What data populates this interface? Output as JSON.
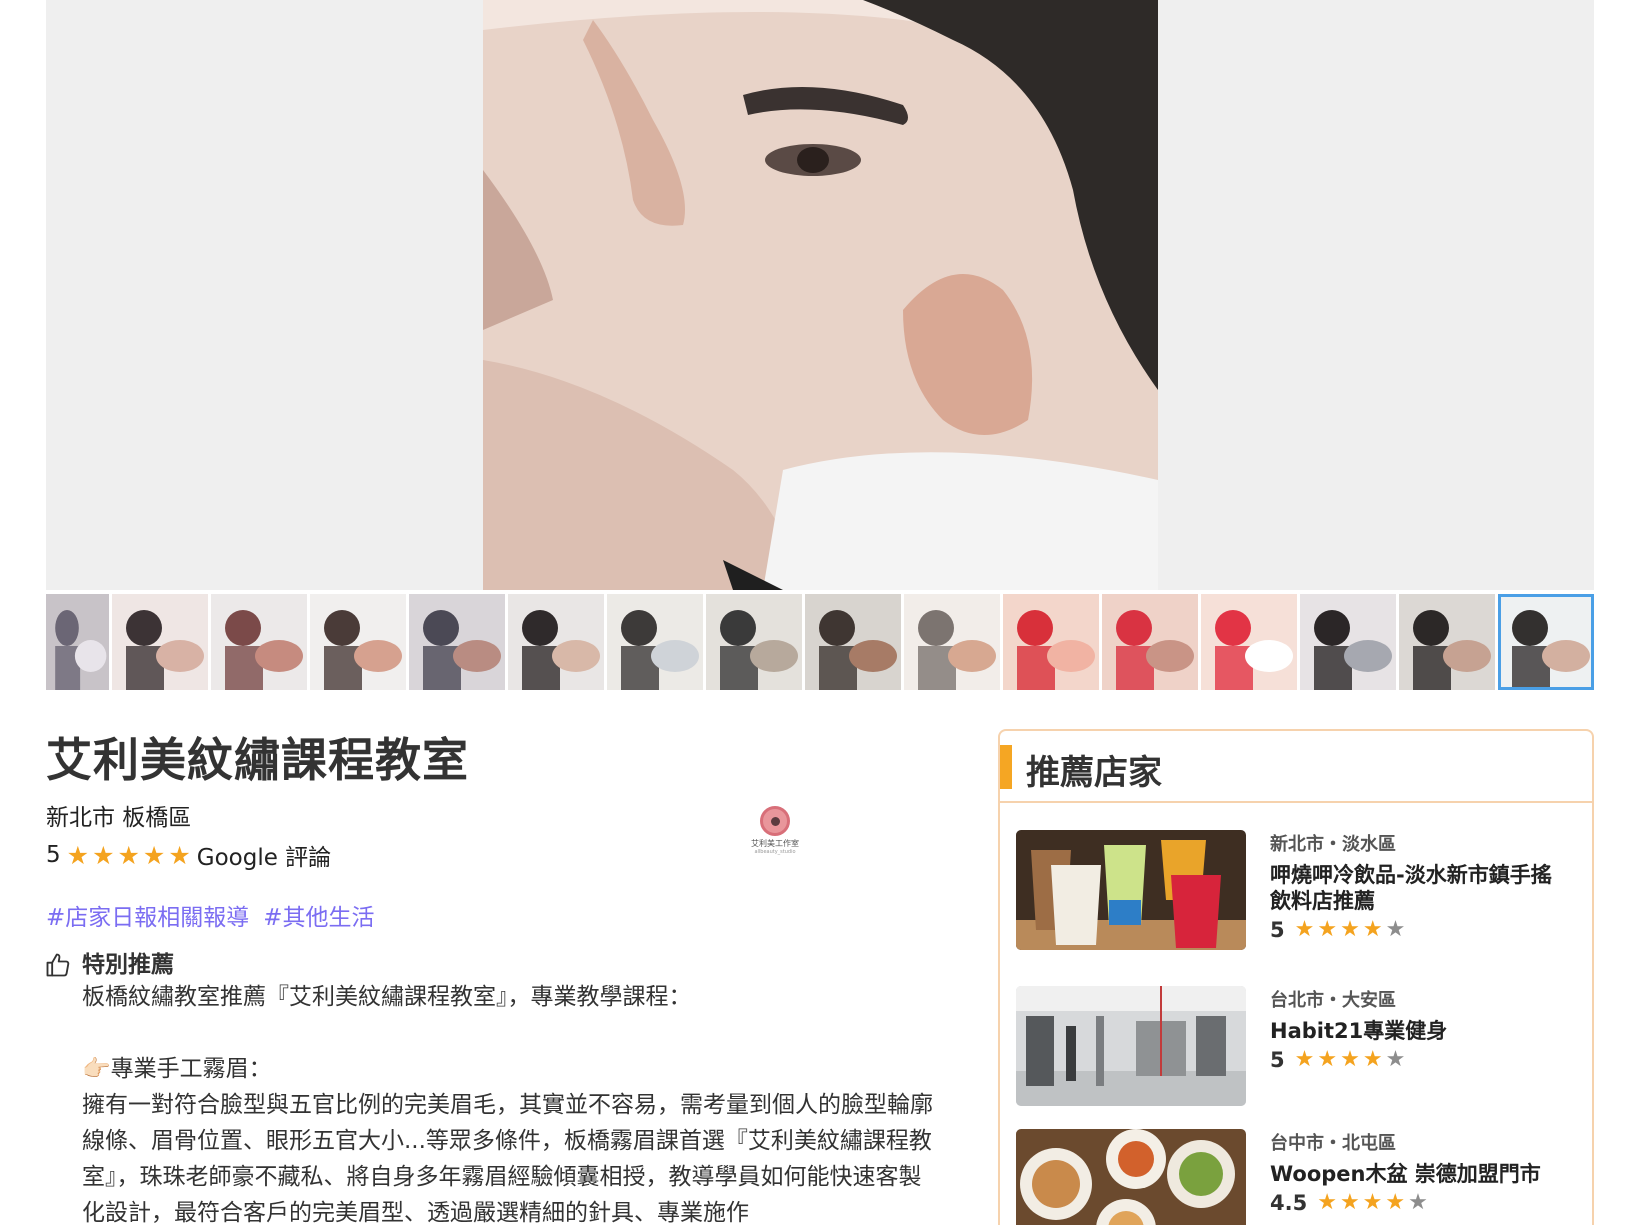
{
  "shop": {
    "title": "艾利美紋繡課程教室",
    "location": "新北市 板橋區",
    "rating": "5",
    "rating_stars": 5,
    "rating_source": "Google 評論",
    "logo_text": "艾利美工作室",
    "logo_sub": "allbeauty_studio"
  },
  "gallery": {
    "thumbnail_count": 16,
    "active_index": 15
  },
  "tags": [
    "#店家日報相關報導",
    "#其他生活"
  ],
  "recommendation": {
    "heading": "特別推薦",
    "icon": "thumbs-up-icon",
    "intro": "板橋紋繡教室推薦『艾利美紋繡課程教室』，專業教學課程：",
    "bullet": "👉🏻專業手工霧眉：",
    "paragraph": "擁有一對符合臉型與五官比例的完美眉毛，其實並不容易，需考量到個人的臉型輪廓線條、眉骨位置、眼形五官大小...等眾多條件，板橋霧眉課首選『艾利美紋繡課程教室』，珠珠老師豪不藏私、將自身多年霧眉經驗傾囊相授，教導學員如何能快速客製化設計，最符合客戶的完美眉型、透過嚴選精細的針具、專業施作"
  },
  "sidebar": {
    "title": "推薦店家",
    "stores": [
      {
        "location": "新北市・淡水區",
        "name": "呷燒呷冷飲品-淡水新市鎮手搖飲料店推薦",
        "rating": "5",
        "stars": 4
      },
      {
        "location": "台北市・大安區",
        "name": "Habit21專業健身",
        "rating": "5",
        "stars": 4
      },
      {
        "location": "台中市・北屯區",
        "name": "Woopen木盆 崇德加盟門市",
        "rating": "4.5",
        "stars": 4
      }
    ]
  },
  "colors": {
    "star": "#f4a31f",
    "star_off": "#8d8d8d",
    "tag": "#7b6df2",
    "accent": "#f5a623",
    "panel_border": "#f6d2ad",
    "active_thumb": "#4a9fe6"
  }
}
